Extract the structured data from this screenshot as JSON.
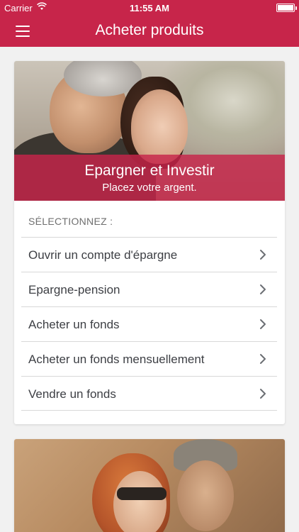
{
  "status_bar": {
    "carrier": "Carrier",
    "time": "11:55 AM",
    "icons": [
      "wifi-icon",
      "battery-icon"
    ]
  },
  "nav": {
    "title": "Acheter produits",
    "menu_icon": "hamburger-menu-icon"
  },
  "colors": {
    "brand": "#c7254a",
    "background": "#f1f1f1",
    "text": "#3d3f44",
    "muted": "#6f6f6f"
  },
  "card": {
    "banner_title": "Epargner et Investir",
    "banner_subtitle": "Placez votre argent.",
    "select_label": "SÉLECTIONNEZ :",
    "items": [
      {
        "label": "Ouvrir un compte d'épargne"
      },
      {
        "label": "Epargne-pension"
      },
      {
        "label": "Acheter un fonds"
      },
      {
        "label": "Acheter un fonds mensuellement"
      },
      {
        "label": "Vendre un fonds"
      }
    ],
    "chevron_icon": "chevron-right-icon"
  }
}
